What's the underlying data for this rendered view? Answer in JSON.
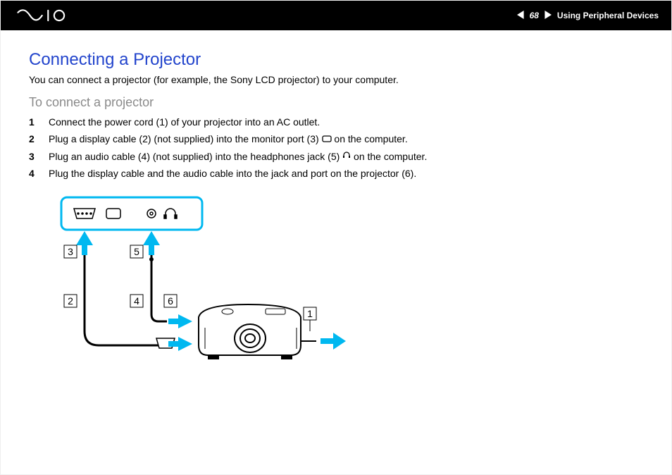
{
  "header": {
    "logo_alt": "VAIO",
    "page_number": "68",
    "section_label": "Using Peripheral Devices"
  },
  "section": {
    "title": "Connecting a Projector",
    "intro": "You can connect a projector (for example, the Sony LCD projector) to your computer.",
    "subtitle": "To connect a projector",
    "steps": [
      {
        "n": "1",
        "text": "Connect the power cord (1) of your projector into an AC outlet."
      },
      {
        "n": "2",
        "pre": "Plug a display cable (2) (not supplied) into the monitor port (3) ",
        "icon": "monitor-port-icon",
        "post": " on the computer."
      },
      {
        "n": "3",
        "pre": "Plug an audio cable (4) (not supplied) into the headphones jack (5) ",
        "icon": "headphones-icon",
        "post": " on the computer."
      },
      {
        "n": "4",
        "text": "Plug the display cable and the audio cable into the jack and port on the projector (6)."
      }
    ]
  },
  "diagram": {
    "callouts": {
      "c1": "1",
      "c2": "2",
      "c3": "3",
      "c4": "4",
      "c5": "5",
      "c6": "6"
    }
  }
}
